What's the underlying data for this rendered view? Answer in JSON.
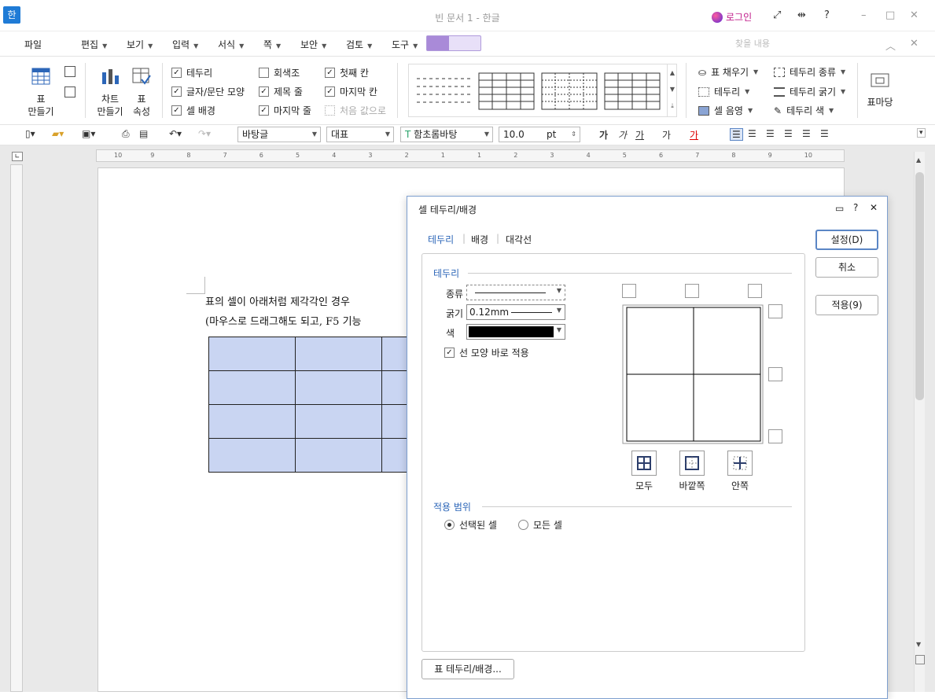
{
  "titlebar": {
    "logo_text": "한",
    "title": "빈 문서 1 - 한글",
    "login": "로그인",
    "help": "?",
    "minimize": "–",
    "maximize": "□",
    "close": "✕"
  },
  "menubar": {
    "items": [
      "파일",
      "편집",
      "보기",
      "입력",
      "서식",
      "쪽",
      "보안",
      "검토",
      "도구"
    ],
    "find_placeholder": "찾을 내용"
  },
  "ribbon": {
    "table_make": [
      "표",
      "만들기"
    ],
    "chart_make": [
      "차트",
      "만들기"
    ],
    "table_props": [
      "표",
      "속성"
    ],
    "checks": [
      {
        "label": "테두리",
        "checked": true
      },
      {
        "label": "글자/문단 모양",
        "checked": true
      },
      {
        "label": "셀 배경",
        "checked": true
      },
      {
        "label": "회색조",
        "checked": false
      },
      {
        "label": "제목 줄",
        "checked": true
      },
      {
        "label": "마지막 줄",
        "checked": true
      },
      {
        "label": "첫째 칸",
        "checked": true
      },
      {
        "label": "마지막 칸",
        "checked": true
      }
    ],
    "reset_label": "처음 값으로",
    "right_tools": [
      "표 채우기",
      "테두리",
      "셀 음영",
      "테두리 종류",
      "테두리 굵기",
      "테두리 색"
    ],
    "table_macro": "표마당"
  },
  "fmtbar": {
    "style": "바탕글",
    "lang": "대표",
    "font": "함초롬바탕",
    "size": "10.0",
    "unit": "pt",
    "bold": "가",
    "italic": "가",
    "underline": "가",
    "strike": "가",
    "color": "가"
  },
  "document": {
    "line1": "표의 셀이 아래처럼 제각각인 경우",
    "line2": "(마우스로 드래그해도 되고, F5 기능"
  },
  "ruler_ticks": [
    "10",
    "9",
    "8",
    "7",
    "6",
    "5",
    "4",
    "3",
    "2",
    "1",
    "1",
    "2",
    "3",
    "4",
    "5",
    "6",
    "7",
    "8",
    "9",
    "10"
  ],
  "dialog": {
    "title": "셀 테두리/배경",
    "tabs": [
      "테두리",
      "배경",
      "대각선"
    ],
    "group_border": "테두리",
    "type_label": "종류",
    "weight_label": "굵기",
    "weight_value": "0.12mm",
    "color_label": "색",
    "apply_shape_label": "선 모양 바로 적용",
    "presets": [
      "모두",
      "바깥쪽",
      "안쪽"
    ],
    "scope_label": "적용 범위",
    "scope_options": [
      "선택된 셀",
      "모든 셀"
    ],
    "bottom_button": "표 테두리/배경...",
    "ok": "설정(D)",
    "cancel": "취소",
    "apply": "적용(9)"
  },
  "colors": {
    "accent": "#2c66b8",
    "cell_fill": "#c9d5f2",
    "dialog_border": "#7e9fcf"
  }
}
